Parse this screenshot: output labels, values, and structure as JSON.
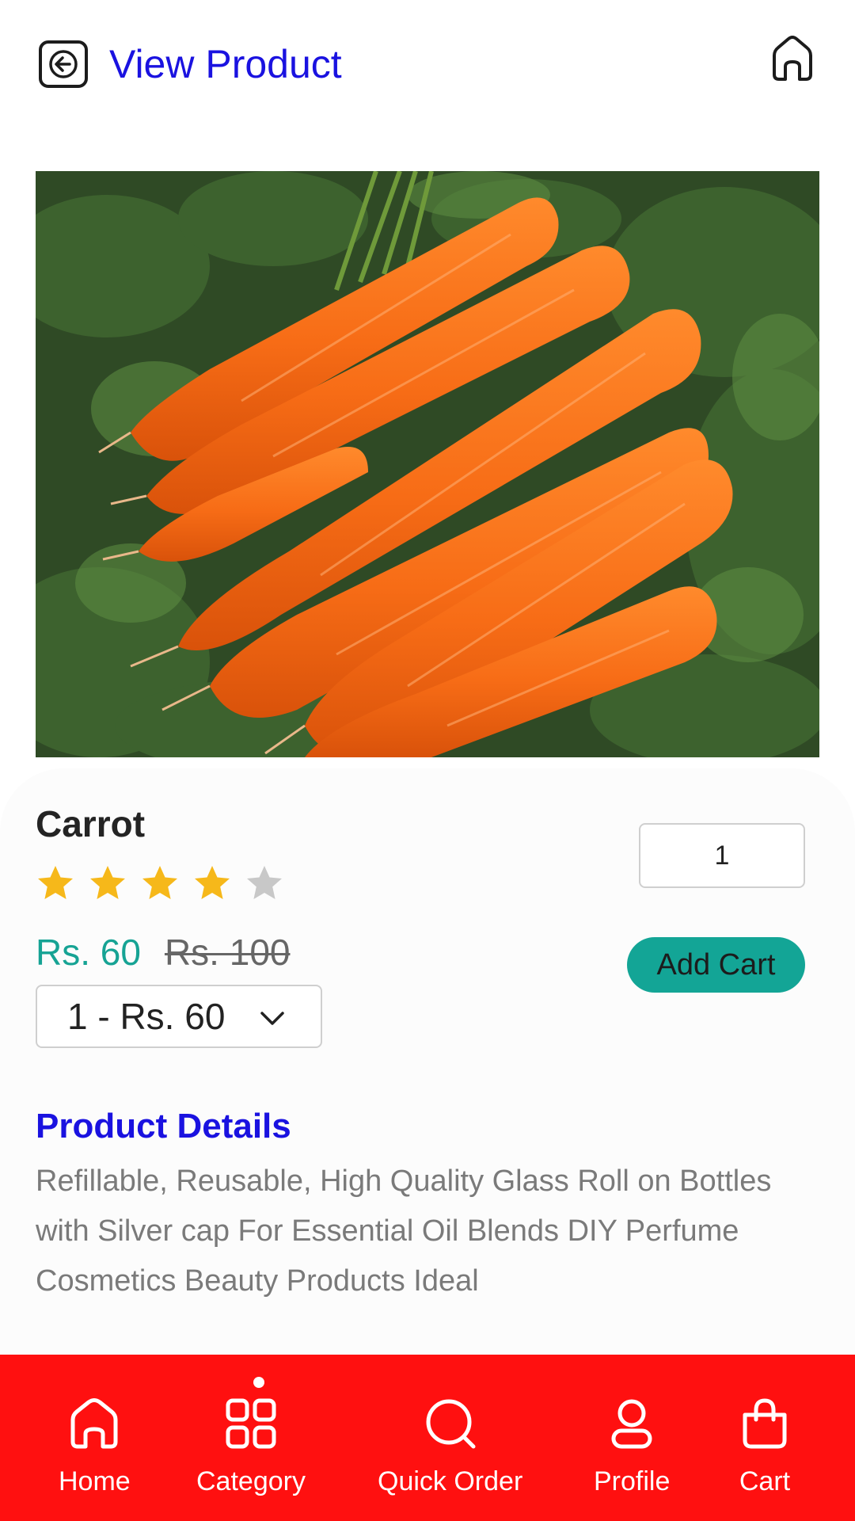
{
  "header": {
    "title": "View Product",
    "back_icon": "arrow-left-square-icon",
    "home_icon": "home-icon"
  },
  "product": {
    "image_description": "carrots",
    "name": "Carrot",
    "rating": 4,
    "rating_max": 5,
    "price_current": "Rs. 60",
    "price_old": "Rs. 100",
    "variant_selected": "1 - Rs. 60",
    "quantity": "1",
    "add_cart_label": "Add Cart"
  },
  "details": {
    "title": "Product Details",
    "text": "Refillable, Reusable, High Quality Glass Roll on Bottles with Silver cap For Essential Oil Blends DIY Perfume Cosmetics Beauty Products Ideal"
  },
  "nav": {
    "items": [
      {
        "label": "Home",
        "icon": "home-icon"
      },
      {
        "label": "Category",
        "icon": "grid-icon",
        "active": true
      },
      {
        "label": "Quick Order",
        "icon": "search-icon"
      },
      {
        "label": "Profile",
        "icon": "user-icon"
      },
      {
        "label": "Cart",
        "icon": "shopping-bag-icon"
      }
    ]
  },
  "colors": {
    "accent_blue": "#1a12e0",
    "price_teal": "#16a394",
    "button_teal": "#13a596",
    "nav_red": "#ff1010",
    "star_gold": "#f6b81a",
    "star_gray": "#c8c8c8"
  }
}
